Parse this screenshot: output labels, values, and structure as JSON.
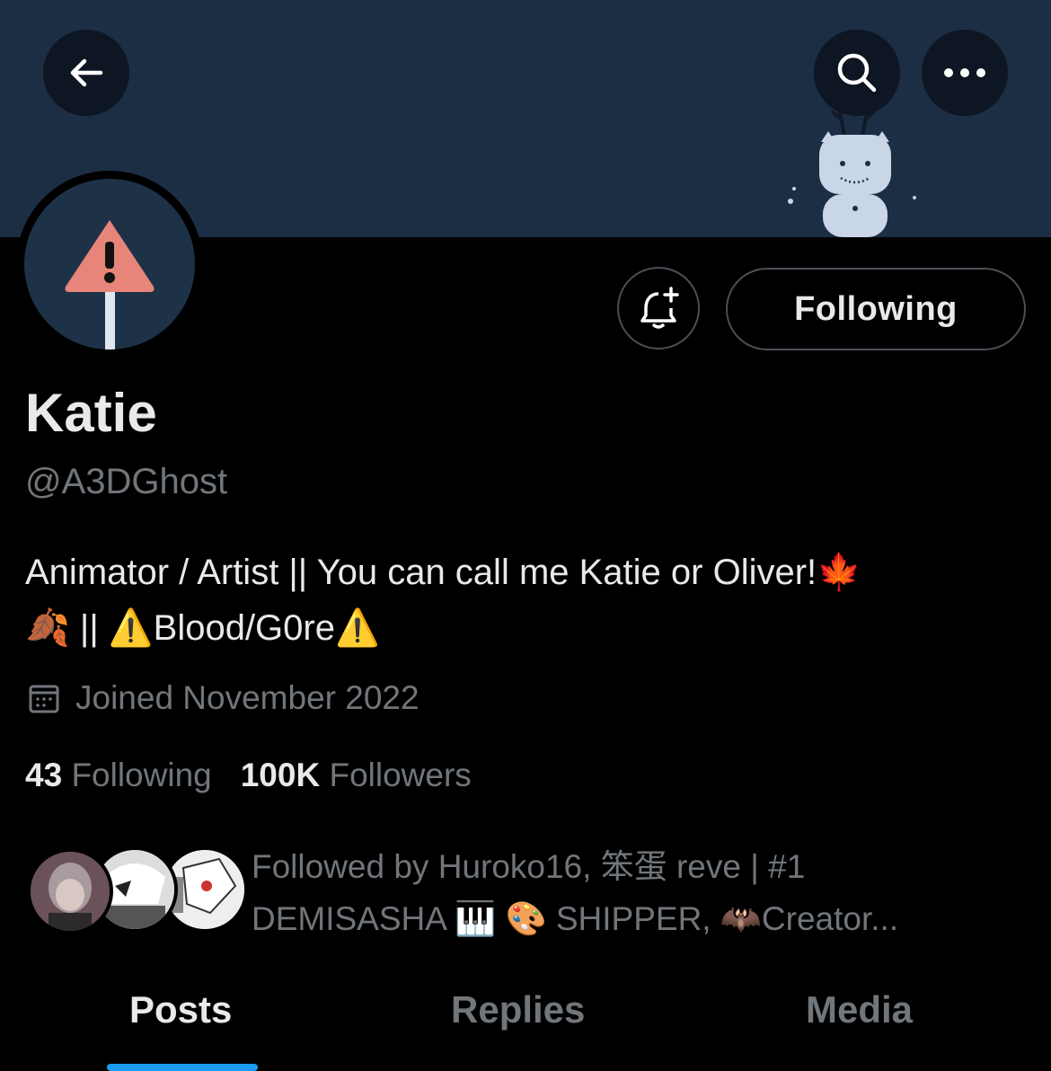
{
  "profile": {
    "display_name": "Katie",
    "handle": "@A3DGhost",
    "bio_line1": "Animator / Artist || You can call me Katie or Oliver!",
    "bio_emoji1": "🍁",
    "bio_emoji2": "🍂",
    "bio_line2_a": " || ",
    "bio_warn1": "⚠️",
    "bio_line2_b": "Blood/G0re",
    "bio_warn2": "⚠️",
    "joined": "Joined November 2022"
  },
  "actions": {
    "following_label": "Following"
  },
  "stats": {
    "following_count": "43",
    "following_label": "Following",
    "followers_count": "100K",
    "followers_label": "Followers"
  },
  "followed_by": {
    "text": "Followed by Huroko16, 笨蛋 reve | #1 DEMISASHA 🎹 🎨 SHIPPER, 🦇Creator..."
  },
  "tabs": [
    {
      "label": "Posts"
    },
    {
      "label": "Replies"
    },
    {
      "label": "Media"
    }
  ],
  "colors": {
    "banner": "#1c2e44",
    "accent": "#1d9bf0",
    "muted": "#71767b",
    "text": "#e7e9ea"
  },
  "icons": {
    "back": "arrow-left-icon",
    "search": "search-icon",
    "more": "more-horizontal-icon",
    "bell": "bell-plus-icon",
    "calendar": "calendar-icon"
  }
}
